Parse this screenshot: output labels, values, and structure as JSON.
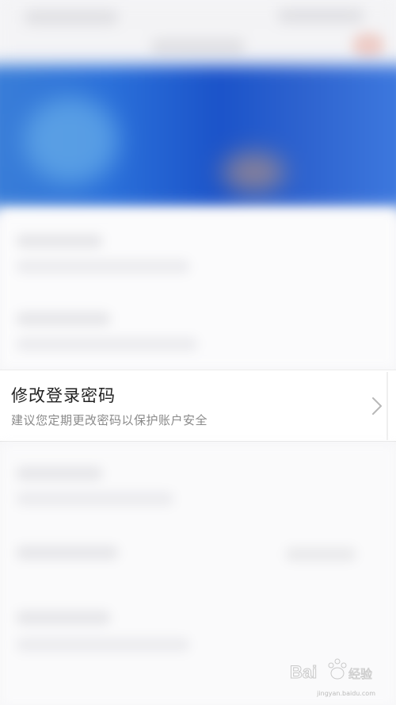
{
  "password_row": {
    "title": "修改登录密码",
    "subtitle": "建议您定期更改密码以保护账户安全",
    "chevron_icon": "chevron-right-icon"
  },
  "watermark": {
    "brand": "Baidu 经验",
    "url": "jingyan.baidu.com"
  },
  "colors": {
    "banner_blue": "#2a6fd9",
    "row_background": "#ffffff",
    "title_text": "#222222",
    "subtitle_text": "#8a8a8a"
  }
}
